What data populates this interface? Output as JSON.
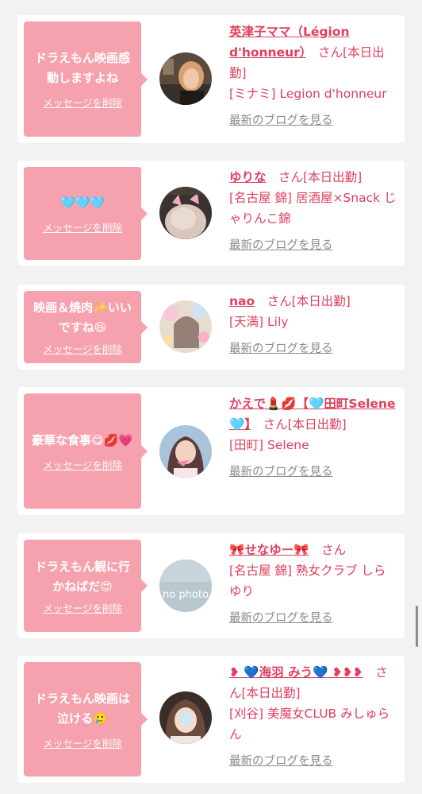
{
  "colors": {
    "accent": "#e0405e",
    "bubble": "#f6a2ae",
    "blog_link": "#8a8a8a",
    "background": "#f2f2f2"
  },
  "common": {
    "delete_label": "メッセージを削除",
    "blog_label": "最新のブログを見る"
  },
  "messages": [
    {
      "bubble": "ドラえもん映画感動しますよね",
      "name": "英津子ママ（Légion d'honneur）",
      "suffix": "　さん[本日出勤]",
      "shop": "[ミナミ] Legion d'honneur",
      "avatar_icon": "woman-photo-icon"
    },
    {
      "bubble": "🩵🩵🩵",
      "name": "ゆりな",
      "suffix": "　さん[本日出勤]",
      "shop": "[名古屋 錦] 居酒屋×Snack じゃりんこ錦",
      "avatar_icon": "woman-photo-icon"
    },
    {
      "bubble": "映画＆焼肉✨いいですね😆",
      "name": "nao",
      "suffix": "　さん[本日出勤]",
      "shop": "[天満] Lily",
      "avatar_icon": "woman-photo-icon"
    },
    {
      "bubble": "豪華な食事😋💋💗",
      "name": "かえで💄💋【🩵田町Selene🩵】",
      "suffix": "　さん[本日出勤]",
      "shop": "[田町] Selene",
      "avatar_icon": "woman-photo-icon"
    },
    {
      "bubble": "ドラえもん観に行かねばだ😍",
      "name": "🎀せなゆー🎀",
      "suffix": "　さん",
      "shop": "[名古屋 錦] 熟女クラブ しらゆり",
      "avatar_icon": "no-photo-icon",
      "avatar_text": "no photo"
    },
    {
      "bubble": "ドラえもん映画は泣ける🥲",
      "name": "❥ 💙海羽 みう💙 ❥❥❥",
      "suffix": "　さん[本日出勤]",
      "shop": "[刈谷] 美魔女CLUB みしゅらん",
      "avatar_icon": "woman-photo-icon"
    }
  ]
}
